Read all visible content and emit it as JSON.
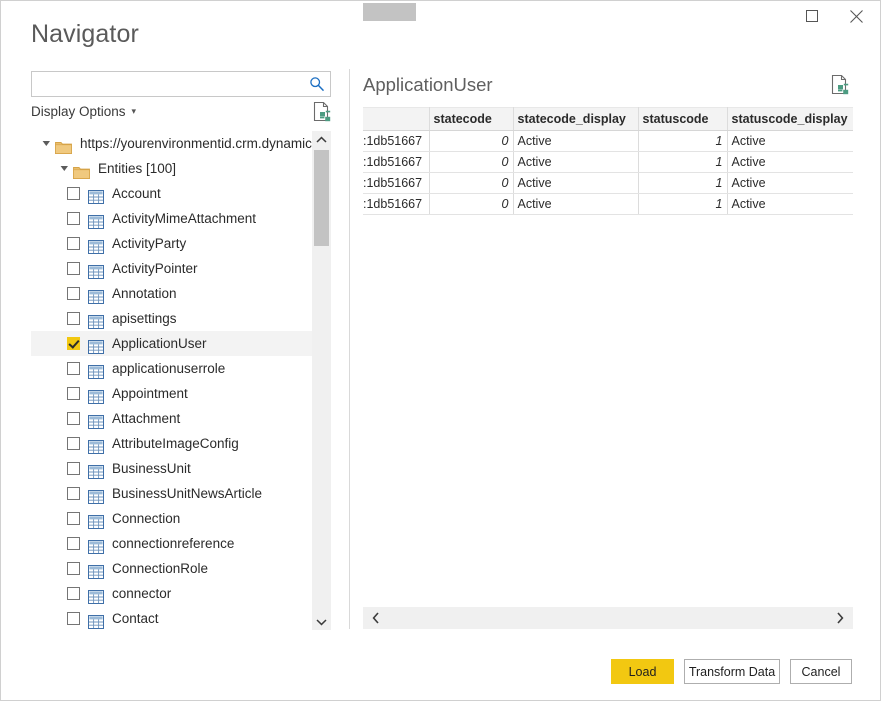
{
  "window": {
    "title": "Navigator",
    "controls": [
      {
        "name": "maximize",
        "glyph": "maximize-icon"
      },
      {
        "name": "close",
        "glyph": "close-icon"
      }
    ]
  },
  "search": {
    "value": "",
    "placeholder": "",
    "icon": "search-icon"
  },
  "display_options": {
    "label": "Display Options",
    "caret": "▾"
  },
  "refresh": {
    "left_icon": "refresh-preview-icon",
    "right_icon": "refresh-preview-icon"
  },
  "tree": {
    "nodes": [
      {
        "kind": "folder",
        "indent": 0,
        "expanded": true,
        "label": "https://yourenvironmentid.crm.dynamics..."
      },
      {
        "kind": "folder",
        "indent": 1,
        "expanded": true,
        "label": "Entities [100]"
      },
      {
        "kind": "item",
        "indent": 2,
        "checked": false,
        "label": "Account"
      },
      {
        "kind": "item",
        "indent": 2,
        "checked": false,
        "label": "ActivityMimeAttachment"
      },
      {
        "kind": "item",
        "indent": 2,
        "checked": false,
        "label": "ActivityParty"
      },
      {
        "kind": "item",
        "indent": 2,
        "checked": false,
        "label": "ActivityPointer"
      },
      {
        "kind": "item",
        "indent": 2,
        "checked": false,
        "label": "Annotation"
      },
      {
        "kind": "item",
        "indent": 2,
        "checked": false,
        "label": "apisettings"
      },
      {
        "kind": "item",
        "indent": 2,
        "checked": true,
        "label": "ApplicationUser",
        "selected": true
      },
      {
        "kind": "item",
        "indent": 2,
        "checked": false,
        "label": "applicationuserrole"
      },
      {
        "kind": "item",
        "indent": 2,
        "checked": false,
        "label": "Appointment"
      },
      {
        "kind": "item",
        "indent": 2,
        "checked": false,
        "label": "Attachment"
      },
      {
        "kind": "item",
        "indent": 2,
        "checked": false,
        "label": "AttributeImageConfig"
      },
      {
        "kind": "item",
        "indent": 2,
        "checked": false,
        "label": "BusinessUnit"
      },
      {
        "kind": "item",
        "indent": 2,
        "checked": false,
        "label": "BusinessUnitNewsArticle"
      },
      {
        "kind": "item",
        "indent": 2,
        "checked": false,
        "label": "Connection"
      },
      {
        "kind": "item",
        "indent": 2,
        "checked": false,
        "label": "connectionreference"
      },
      {
        "kind": "item",
        "indent": 2,
        "checked": false,
        "label": "ConnectionRole"
      },
      {
        "kind": "item",
        "indent": 2,
        "checked": false,
        "label": "connector"
      },
      {
        "kind": "item",
        "indent": 2,
        "checked": false,
        "label": "Contact"
      }
    ]
  },
  "preview": {
    "title": "ApplicationUser",
    "columns": [
      "",
      "statecode",
      "statecode_display",
      "statuscode",
      "statuscode_display"
    ],
    "rows": [
      [
        ":1db51667",
        "0",
        "Active",
        "1",
        "Active"
      ],
      [
        ":1db51667",
        "0",
        "Active",
        "1",
        "Active"
      ],
      [
        ":1db51667",
        "0",
        "Active",
        "1",
        "Active"
      ],
      [
        ":1db51667",
        "0",
        "Active",
        "1",
        "Active"
      ]
    ]
  },
  "footer": {
    "load_label": "Load",
    "transform_label": "Transform Data",
    "cancel_label": "Cancel"
  },
  "colors": {
    "accent": "#f2c811",
    "selection": "#f3f3f3",
    "header_bg": "#f3f3f3",
    "scrollbar_thumb": "#c3c3c3"
  }
}
